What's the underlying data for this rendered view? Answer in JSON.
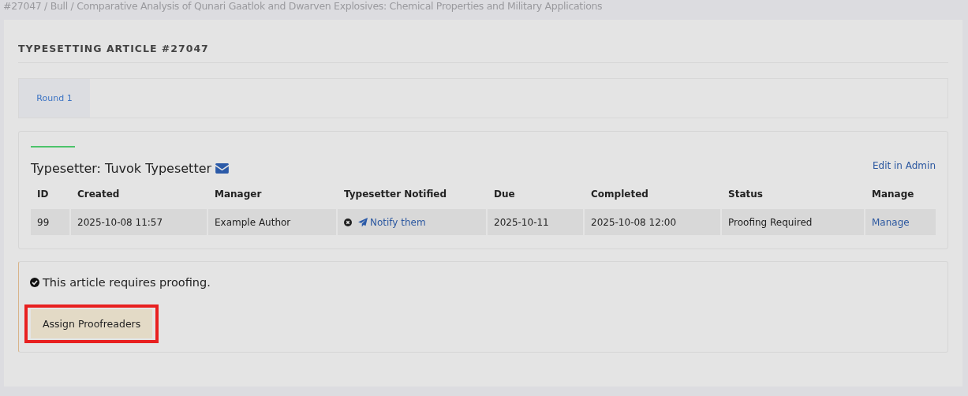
{
  "breadcrumb": "#27047 / Bull / Comparative Analysis of Qunari Gaatlok and Dwarven Explosives: Chemical Properties and Military Applications",
  "page_title": "TYPESETTING ARTICLE #27047",
  "tabs": [
    {
      "label": "Round 1",
      "selected": true
    }
  ],
  "assignment": {
    "heading": "Typesetter: Tuvok Typesetter",
    "admin_link": "Edit in Admin",
    "table": {
      "columns": [
        "ID",
        "Created",
        "Manager",
        "Typesetter Notified",
        "Due",
        "Completed",
        "Status",
        "Manage"
      ],
      "rows": [
        {
          "cells": [
            "99",
            "2025-10-08 11:57",
            "Example Author",
            {
              "notified": false,
              "link": "Notify them"
            },
            "2025-10-11",
            "2025-10-08 12:00",
            "Proofing Required",
            {
              "link": "Manage"
            }
          ]
        }
      ]
    }
  },
  "notice": {
    "message": "This article requires proofing.",
    "button": {
      "label": "Assign Proofreaders",
      "highlighted": true
    }
  }
}
